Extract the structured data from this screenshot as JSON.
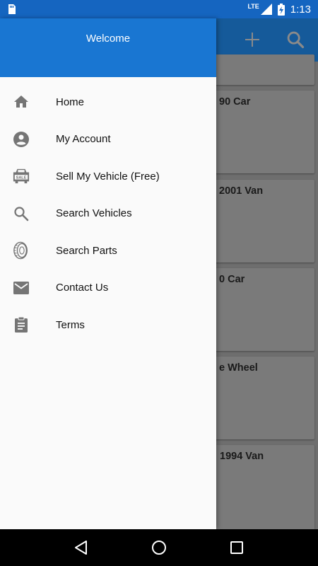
{
  "status_bar": {
    "time": "1:13",
    "network": "LTE",
    "icons": [
      "sim-icon",
      "signal-icon",
      "battery-charging-icon"
    ]
  },
  "app_bar": {
    "actions": [
      "add-icon",
      "search-icon"
    ]
  },
  "background_cards": [
    {
      "title": "90 Car"
    },
    {
      "title": "2001 Van"
    },
    {
      "title": "0 Car"
    },
    {
      "title": "e Wheel"
    },
    {
      "title": "1994 Van"
    }
  ],
  "drawer": {
    "header_title": "Welcome",
    "items": [
      {
        "label": "Home",
        "icon": "home-icon"
      },
      {
        "label": "My Account",
        "icon": "account-circle-icon"
      },
      {
        "label": "Sell My Vehicle (Free)",
        "icon": "car-sale-icon"
      },
      {
        "label": "Search Vehicles",
        "icon": "search-icon"
      },
      {
        "label": "Search Parts",
        "icon": "tire-icon"
      },
      {
        "label": "Contact Us",
        "icon": "mail-icon"
      },
      {
        "label": "Terms",
        "icon": "clipboard-icon"
      }
    ]
  },
  "nav_bar": {
    "buttons": [
      "back-icon",
      "home-circle-icon",
      "recents-icon"
    ]
  },
  "colors": {
    "header_blue": "#1976d2",
    "status_bar_blue": "#1565c0",
    "icon_gray": "#757575"
  }
}
